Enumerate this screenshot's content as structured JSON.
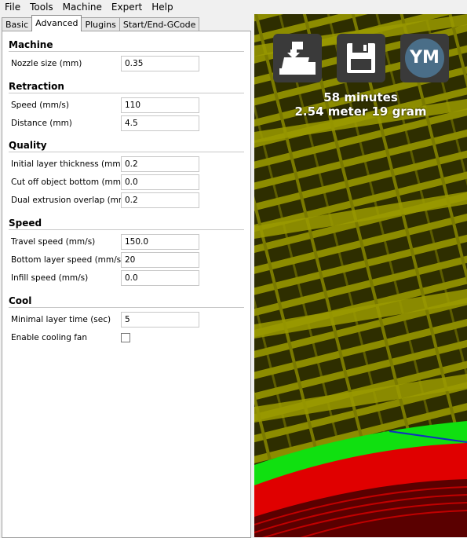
{
  "menu": [
    "File",
    "Tools",
    "Machine",
    "Expert",
    "Help"
  ],
  "tabs": [
    {
      "label": "Basic",
      "active": false
    },
    {
      "label": "Advanced",
      "active": true
    },
    {
      "label": "Plugins",
      "active": false
    },
    {
      "label": "Start/End-GCode",
      "active": false
    }
  ],
  "sections": {
    "machine": {
      "title": "Machine",
      "nozzle_size": {
        "label": "Nozzle size (mm)",
        "value": "0.35"
      }
    },
    "retraction": {
      "title": "Retraction",
      "speed": {
        "label": "Speed (mm/s)",
        "value": "110"
      },
      "distance": {
        "label": "Distance (mm)",
        "value": "4.5"
      }
    },
    "quality": {
      "title": "Quality",
      "initial_layer": {
        "label": "Initial layer thickness (mm)",
        "value": "0.2"
      },
      "cut_off": {
        "label": "Cut off object bottom (mm)",
        "value": "0.0"
      },
      "dual_overlap": {
        "label": "Dual extrusion overlap (mm)",
        "value": "0.2"
      }
    },
    "speed": {
      "title": "Speed",
      "travel": {
        "label": "Travel speed (mm/s)",
        "value": "150.0"
      },
      "bottom_layer": {
        "label": "Bottom layer speed (mm/s)",
        "value": "20"
      },
      "infill": {
        "label": "Infill speed (mm/s)",
        "value": "0.0"
      }
    },
    "cool": {
      "title": "Cool",
      "min_layer_time": {
        "label": "Minimal layer time (sec)",
        "value": "5"
      },
      "cooling_fan": {
        "label": "Enable cooling fan",
        "checked": false
      }
    }
  },
  "viewport": {
    "buttons": [
      {
        "name": "load-icon"
      },
      {
        "name": "save-icon"
      },
      {
        "name": "youmagine-icon",
        "text": "YM"
      }
    ],
    "print_time": "58 minutes",
    "print_material": "2.54 meter 19 gram",
    "colors": {
      "infill": "#8a8a00",
      "background": "#3d3d00",
      "outer_wall": "#e00000",
      "inner_wall": "#00e000",
      "travel": "#1030c0"
    }
  }
}
